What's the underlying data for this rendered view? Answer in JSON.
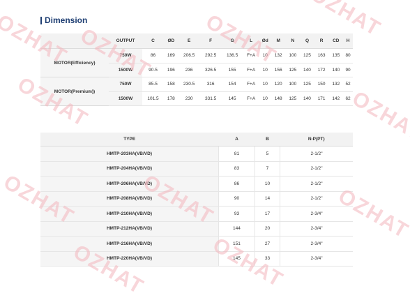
{
  "heading": "Dimension",
  "watermark": "OZHAT",
  "table1": {
    "headers": [
      "",
      "OUTPUT",
      "C",
      "ØD",
      "E",
      "F",
      "G",
      "L",
      "Ød",
      "M",
      "N",
      "Q",
      "R",
      "CD",
      "H"
    ],
    "groups": [
      {
        "label": "MOTOR(Efficiency)",
        "rows": [
          {
            "output": "750W",
            "values": [
              "86",
              "169",
              "206.5",
              "292.5",
              "136.5",
              "F+A",
              "10",
              "132",
              "100",
              "125",
              "163",
              "135",
              "80"
            ]
          },
          {
            "output": "1500W",
            "values": [
              "90.5",
              "196",
              "236",
              "326.5",
              "155",
              "F+A",
              "10",
              "156",
              "125",
              "140",
              "172",
              "140",
              "90"
            ]
          }
        ]
      },
      {
        "label": "MOTOR(Premium))",
        "rows": [
          {
            "output": "750W",
            "values": [
              "85.5",
              "158",
              "230.5",
              "316",
              "154",
              "F+A",
              "10",
              "120",
              "100",
              "125",
              "150",
              "132",
              "52"
            ]
          },
          {
            "output": "1500W",
            "values": [
              "101.5",
              "178",
              "230",
              "331.5",
              "145",
              "F+A",
              "10",
              "148",
              "125",
              "140",
              "171",
              "142",
              "62"
            ]
          }
        ]
      }
    ]
  },
  "table2": {
    "headers": [
      "TYPE",
      "A",
      "B",
      "N-P(PT)"
    ],
    "rows": [
      [
        "HMTP-203HA(VB/VD)",
        "81",
        "5",
        "2-1/2\""
      ],
      [
        "HMTP-204HA(VB/VD)",
        "83",
        "7",
        "2-1/2\""
      ],
      [
        "HMTP-206HA(VB/VD)",
        "86",
        "10",
        "2-1/2\""
      ],
      [
        "HMTP-208HA(VB/VD)",
        "90",
        "14",
        "2-1/2\""
      ],
      [
        "HMTP-210HA(VB/VD)",
        "93",
        "17",
        "2-3/4\""
      ],
      [
        "HMTP-212HA(VB/VD)",
        "144",
        "20",
        "2-3/4\""
      ],
      [
        "HMTP-216HA(VB/VD)",
        "151",
        "27",
        "2-3/4\""
      ],
      [
        "HMTP-220HA(VB/VD)",
        "145",
        "33",
        "2-3/4\""
      ]
    ]
  }
}
